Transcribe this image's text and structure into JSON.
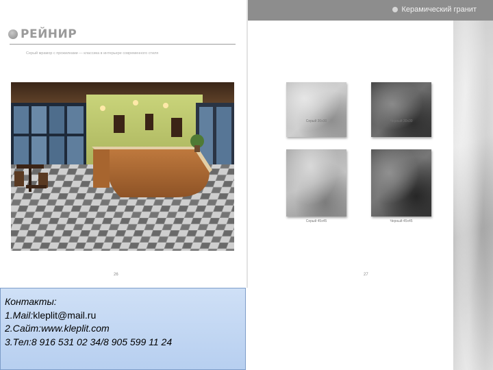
{
  "left_page": {
    "brand_title": "РЕЙНИР",
    "description": "Серый мрамор с прожилками — классика в интерьере современного стиля",
    "page_number": "26"
  },
  "right_page": {
    "header_title": "Керамический гранит",
    "tiles": [
      {
        "label": "Серый 30х30"
      },
      {
        "label": "Черный 30х30"
      },
      {
        "label": "Серый 45х45"
      },
      {
        "label": "Черный 45х45"
      }
    ],
    "page_number": "27"
  },
  "contacts": {
    "title": "Контакты:",
    "line1_prefix": "1.Mail:",
    "line1_value": "kleplit@mail.ru",
    "line2": "2.Сайт:www.kleplit.com",
    "line3": "3.Тел:8 916 531 02 34/8 905 599 11 24"
  }
}
